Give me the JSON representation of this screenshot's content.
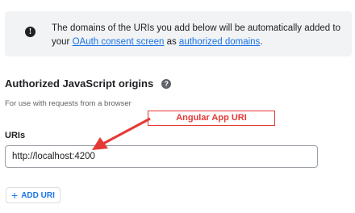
{
  "notice": {
    "text_before": "The domains of the URIs you add below will be automatically added to your ",
    "link1": "OAuth consent screen",
    "text_mid": " as ",
    "link2": "authorized domains",
    "text_after": "."
  },
  "section": {
    "title": "Authorized JavaScript origins",
    "subtitle": "For use with requests from a browser"
  },
  "uris": {
    "label": "URIs",
    "value": "http://localhost:4200"
  },
  "add_button": {
    "label": "ADD URI"
  },
  "annotation": {
    "text": "Angular App URI",
    "color": "#e53935"
  },
  "colors": {
    "accent": "#1a73e8"
  }
}
